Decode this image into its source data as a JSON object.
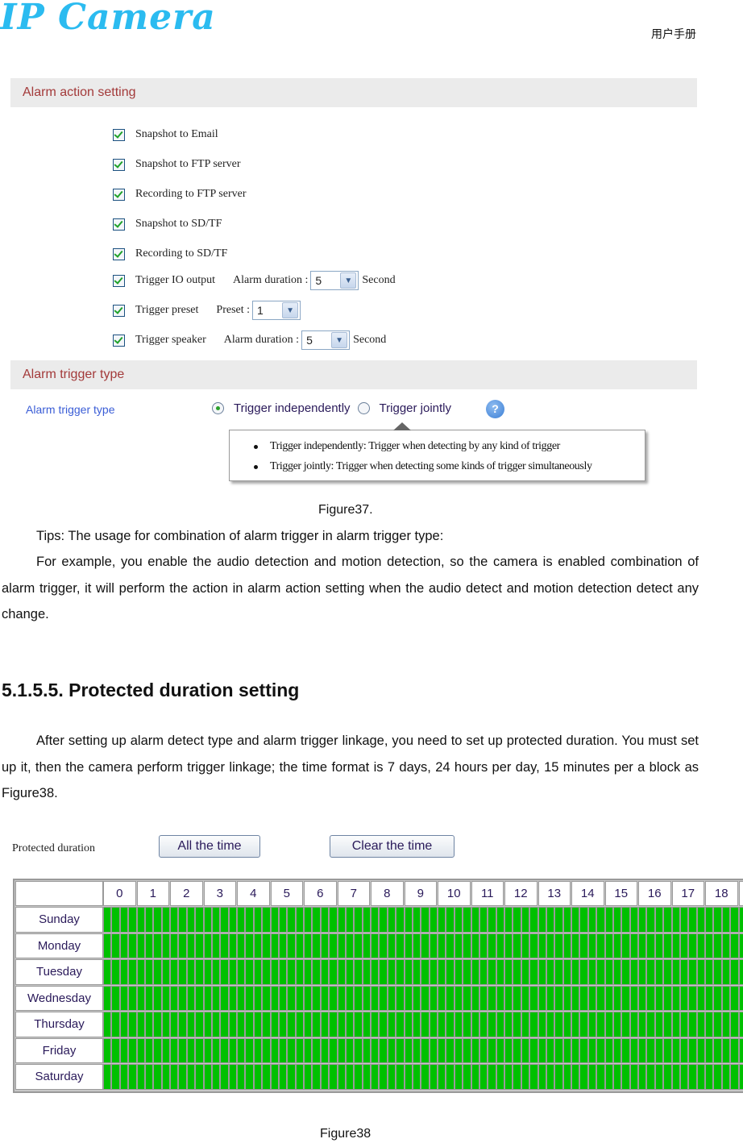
{
  "header": {
    "logo_text": "IP Camera",
    "doc_label": "用户手册"
  },
  "figure37": {
    "alarm_action": {
      "title": "Alarm action setting",
      "items": [
        {
          "label": "Snapshot to Email",
          "checked": true
        },
        {
          "label": "Snapshot to FTP server",
          "checked": true
        },
        {
          "label": "Recording to FTP server",
          "checked": true
        },
        {
          "label": "Snapshot to SD/TF",
          "checked": true
        },
        {
          "label": "Recording to SD/TF",
          "checked": true
        },
        {
          "label": "Trigger IO output",
          "checked": true,
          "field_label": "Alarm duration :",
          "field_value": "5",
          "unit": "Second"
        },
        {
          "label": "Trigger preset",
          "checked": true,
          "field_label": "Preset :",
          "field_value": "1"
        },
        {
          "label": "Trigger speaker",
          "checked": true,
          "field_label": "Alarm duration :",
          "field_value": "5",
          "unit": "Second"
        }
      ]
    },
    "alarm_trigger": {
      "title": "Alarm trigger type",
      "row_label": "Alarm trigger type",
      "options": [
        {
          "label": "Trigger independently",
          "selected": true
        },
        {
          "label": "Trigger jointly",
          "selected": false
        }
      ],
      "help_icon": "question-mark",
      "tooltip": [
        "Trigger independently: Trigger when detecting by any kind of trigger",
        "Trigger jointly: Trigger when detecting some kinds of trigger simultaneously"
      ]
    },
    "caption": "Figure37."
  },
  "body_text": {
    "tips": "Tips: The usage for combination of alarm trigger in alarm trigger type:",
    "example": "For example, you enable the audio detection and motion detection, so the camera is enabled combination of alarm trigger, it will perform the action in alarm action setting when the audio detect and motion detection detect any change.",
    "heading": "5.1.5.5. Protected duration setting",
    "protected_intro": "After setting up alarm detect type and alarm trigger linkage, you need to set up protected duration. You must set up it, then the camera perform trigger linkage; the time format is 7 days, 24 hours per day, 15 minutes per a block as Figure38."
  },
  "figure38": {
    "label": "Protected duration",
    "all_time_button": "All the time",
    "clear_time_button": "Clear the time",
    "hours": [
      "0",
      "1",
      "2",
      "3",
      "4",
      "5",
      "6",
      "7",
      "8",
      "9",
      "10",
      "11",
      "12",
      "13",
      "14",
      "15",
      "16",
      "17",
      "18"
    ],
    "days": [
      "Sunday",
      "Monday",
      "Tuesday",
      "Wednesday",
      "Thursday",
      "Friday",
      "Saturday"
    ],
    "blocks_per_hour": 4,
    "all_blocks_selected": true,
    "selected_color": "#00c000",
    "caption": "Figure38"
  }
}
